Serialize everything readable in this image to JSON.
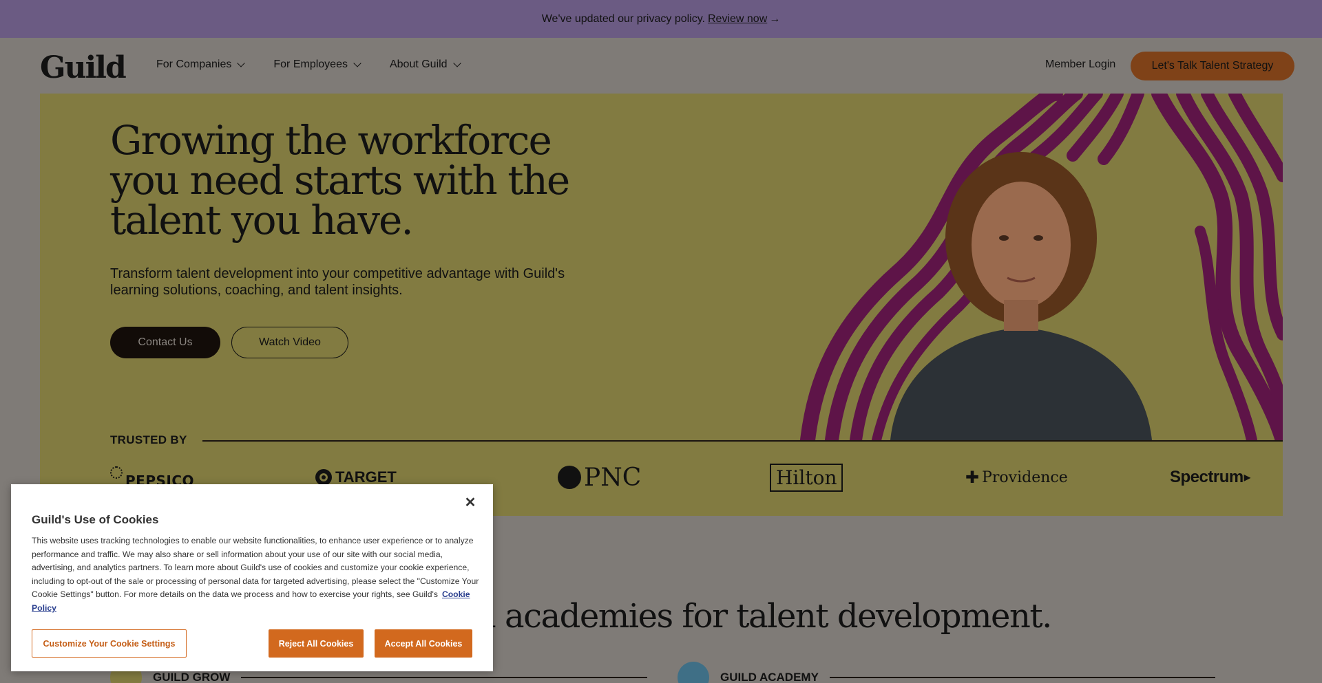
{
  "banner": {
    "text": "We've updated our privacy policy.",
    "link": "Review now",
    "arrow": "→"
  },
  "header": {
    "logo": "Guild",
    "nav": [
      {
        "label": "For Companies"
      },
      {
        "label": "For Employees"
      },
      {
        "label": "About Guild"
      }
    ],
    "member_login": "Member Login",
    "cta": "Let's Talk Talent Strategy"
  },
  "hero": {
    "title": "Growing the workforce you need starts with the talent you have.",
    "subtitle": "Transform talent development into your competitive advantage with Guild's learning solutions, coaching, and talent insights.",
    "contact_button": "Contact Us",
    "video_button": "Watch Video",
    "trusted_by": "TRUSTED BY",
    "logos": [
      "PEPSICO",
      "TARGET",
      "PNC",
      "Hilton",
      "Providence",
      "Spectrum"
    ],
    "accent_colors": {
      "background": "#827b41",
      "wave_purple": "#5e1448",
      "wave_yellow": "#8d8443"
    }
  },
  "section": {
    "heading_visible": "d academies for talent development.",
    "products": [
      {
        "label": "GUILD GROW"
      },
      {
        "label": "GUILD ACADEMY"
      }
    ]
  },
  "cookie": {
    "title": "Guild's Use of Cookies",
    "body": "This website uses tracking technologies to enable our website functionalities, to enhance user experience or to analyze performance and traffic. We may also share or sell information about your use of our site with our social media, advertising, and analytics partners. To learn more about Guild's use of cookies and customize your cookie experience, including to opt-out of the sale or processing of personal data for targeted advertising, please select the \"Customize Your Cookie Settings\" button. For more details on the data we process and how to exercise your rights, see Guild's",
    "policy_link": "Cookie Policy",
    "close": "✕",
    "customize_button": "Customize Your Cookie Settings",
    "reject_button": "Reject All Cookies",
    "accept_button": "Accept All Cookies"
  }
}
